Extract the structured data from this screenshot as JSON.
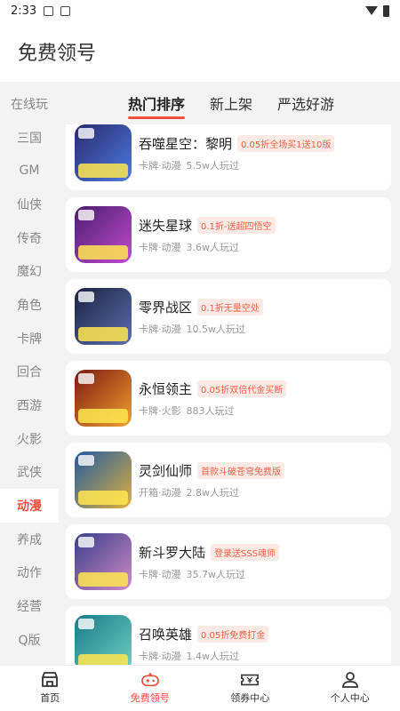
{
  "status_bar": {
    "time": "2:33"
  },
  "header": {
    "title": "免费领号"
  },
  "sidebar": {
    "items": [
      {
        "label": "在线玩",
        "active": false
      },
      {
        "label": "三国",
        "active": false
      },
      {
        "label": "GM",
        "active": false
      },
      {
        "label": "仙侠",
        "active": false
      },
      {
        "label": "传奇",
        "active": false
      },
      {
        "label": "魔幻",
        "active": false
      },
      {
        "label": "角色",
        "active": false
      },
      {
        "label": "卡牌",
        "active": false
      },
      {
        "label": "回合",
        "active": false
      },
      {
        "label": "西游",
        "active": false
      },
      {
        "label": "火影",
        "active": false
      },
      {
        "label": "武侠",
        "active": false
      },
      {
        "label": "动漫",
        "active": true
      },
      {
        "label": "养成",
        "active": false
      },
      {
        "label": "动作",
        "active": false
      },
      {
        "label": "经营",
        "active": false
      },
      {
        "label": "Q版",
        "active": false
      }
    ]
  },
  "tabs": [
    {
      "label": "热门排序",
      "active": true
    },
    {
      "label": "新上架",
      "active": false
    },
    {
      "label": "严选好游",
      "active": false
    }
  ],
  "games": [
    {
      "name": "吞噬星空：黎明",
      "promo": "0.05折全场买1送10版",
      "tags": "卡牌·动漫",
      "players": "5.5w人玩过",
      "colors": [
        "#2b2a6e",
        "#4b7be0"
      ]
    },
    {
      "name": "迷失星球",
      "promo": "0.1折-送超四悟空",
      "tags": "卡牌·动漫",
      "players": "3.6w人玩过",
      "colors": [
        "#4a1e6e",
        "#c34ad0"
      ]
    },
    {
      "name": "零界战区",
      "promo": "0.1折无量空处",
      "tags": "卡牌·动漫",
      "players": "10.5w人玩过",
      "colors": [
        "#1c2340",
        "#5a6fb0"
      ]
    },
    {
      "name": "永恒领主",
      "promo": "0.05折双倍代金买断",
      "tags": "卡牌·火影",
      "players": "883人玩过",
      "colors": [
        "#7a1a10",
        "#f0a030"
      ]
    },
    {
      "name": "灵剑仙师",
      "promo": "首款斗破苍穹免费版",
      "tags": "开箱·动漫",
      "players": "2.8w人玩过",
      "colors": [
        "#1f5a9e",
        "#e0b040"
      ]
    },
    {
      "name": "新斗罗大陆",
      "promo": "登录送SSS魂师",
      "tags": "卡牌·动漫",
      "players": "35.7w人玩过",
      "colors": [
        "#3a3f8a",
        "#d08ac8"
      ]
    },
    {
      "name": "召唤英雄",
      "promo": "0.05折免费打金",
      "tags": "卡牌·动漫",
      "players": "1.4w人玩过",
      "colors": [
        "#1a7a8a",
        "#70d0c0"
      ]
    }
  ],
  "bottom_nav": [
    {
      "label": "首页",
      "icon": "store-icon",
      "active": false
    },
    {
      "label": "免费领号",
      "icon": "gamepad-icon",
      "active": true
    },
    {
      "label": "领券中心",
      "icon": "coupon-icon",
      "active": false
    },
    {
      "label": "个人中心",
      "icon": "person-icon",
      "active": false
    }
  ],
  "colors": {
    "accent": "#f04e3e",
    "promo_bg": "#fdeae5",
    "background": "#f3f3f3"
  }
}
